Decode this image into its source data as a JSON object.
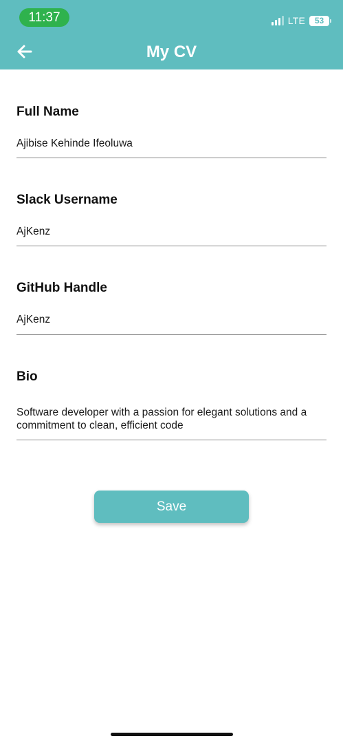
{
  "status_bar": {
    "time": "11:37",
    "network": "LTE",
    "battery": "53"
  },
  "header": {
    "title": "My CV",
    "back_icon": "arrow-left-icon",
    "color": "#5fbdbf"
  },
  "form": {
    "full_name": {
      "label": "Full Name",
      "value": "Ajibise Kehinde Ifeoluwa"
    },
    "slack_username": {
      "label": "Slack Username",
      "value": "AjKenz"
    },
    "github_handle": {
      "label": "GitHub Handle",
      "value": "AjKenz"
    },
    "bio": {
      "label": "Bio",
      "value": "Software developer with a passion for elegant solutions and a commitment to clean, efficient code"
    }
  },
  "actions": {
    "save_label": "Save"
  }
}
